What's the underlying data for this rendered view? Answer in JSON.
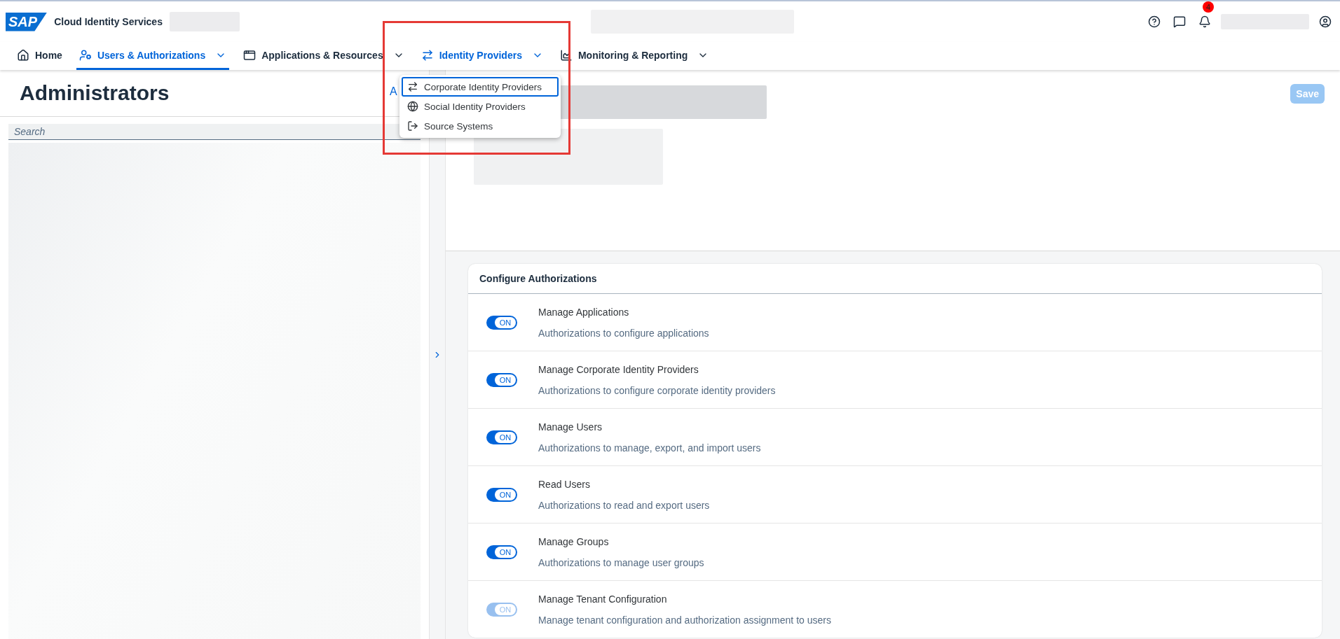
{
  "header": {
    "product": "Cloud Identity Services",
    "logo": "SAP",
    "notifications": "4"
  },
  "nav": [
    {
      "label": "Home",
      "kind": "home",
      "selected": false,
      "expanded": false,
      "menu": false
    },
    {
      "label": "Users & Authorizations",
      "kind": "users",
      "selected": true,
      "expanded": false,
      "menu": true
    },
    {
      "label": "Applications & Resources",
      "kind": "apps",
      "selected": false,
      "expanded": false,
      "menu": true
    },
    {
      "label": "Identity Providers",
      "kind": "idp",
      "selected": false,
      "expanded": true,
      "menu": true
    },
    {
      "label": "Monitoring & Reporting",
      "kind": "monitor",
      "selected": false,
      "expanded": false,
      "menu": true
    }
  ],
  "dropdown": [
    {
      "label": "Corporate Identity Providers",
      "kind": "idp",
      "selected": true
    },
    {
      "label": "Social Identity Providers",
      "kind": "globe",
      "selected": false
    },
    {
      "label": "Source Systems",
      "kind": "exit",
      "selected": false
    }
  ],
  "page": {
    "title": "Administrators",
    "link": "A",
    "save": "Save",
    "search_placeholder": "Search"
  },
  "card": {
    "title": "Configure Authorizations",
    "rows": [
      {
        "name": "Manage Applications",
        "description": "Authorizations to configure applications",
        "toggle_label": "ON",
        "on": true,
        "disabled": false
      },
      {
        "name": "Manage Corporate Identity Providers",
        "description": "Authorizations to configure corporate identity providers",
        "toggle_label": "ON",
        "on": true,
        "disabled": false
      },
      {
        "name": "Manage Users",
        "description": "Authorizations to manage, export, and import users",
        "toggle_label": "ON",
        "on": true,
        "disabled": false
      },
      {
        "name": "Read Users",
        "description": "Authorizations to read and export users",
        "toggle_label": "ON",
        "on": true,
        "disabled": false
      },
      {
        "name": "Manage Groups",
        "description": "Authorizations to manage user groups",
        "toggle_label": "ON",
        "on": true,
        "disabled": false
      },
      {
        "name": "Manage Tenant Configuration",
        "description": "Manage tenant configuration and authorization assignment to users",
        "toggle_label": "ON",
        "on": true,
        "disabled": true
      }
    ]
  }
}
